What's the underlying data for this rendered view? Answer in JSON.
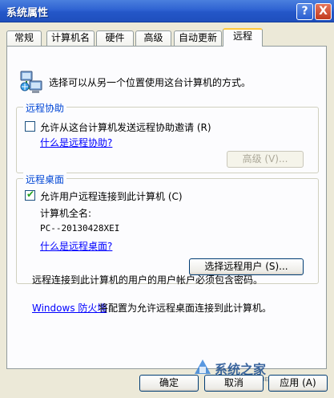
{
  "window": {
    "title": "系统属性",
    "help_glyph": "?",
    "close_glyph": "X"
  },
  "tabs": [
    {
      "label": "常规"
    },
    {
      "label": "计算机名"
    },
    {
      "label": "硬件"
    },
    {
      "label": "高级"
    },
    {
      "label": "自动更新"
    },
    {
      "label": "远程",
      "active": true
    }
  ],
  "intro": {
    "icon": "remote-computers-icon",
    "text": "选择可以从另一个位置使用这台计算机的方式。"
  },
  "remote_assistance": {
    "legend": "远程协助",
    "checkbox_label": "允许从这台计算机发送远程协助邀请 (R)",
    "checked": false,
    "link": "什么是远程协助?",
    "advanced_button": "高级 (V)..."
  },
  "remote_desktop": {
    "legend": "远程桌面",
    "checkbox_label": "允许用户远程连接到此计算机 (C)",
    "checked": true,
    "full_name_label": "计算机全名:",
    "full_name_value": "PC--20130428XEI",
    "link": "什么是远程桌面?",
    "select_users_button": "选择远程用户 (S)..."
  },
  "password_note": "远程连接到此计算机的用户的用户帐户必须包含密码。",
  "firewall": {
    "link": "Windows 防火墙",
    "text": "将配置为允许远程桌面连接到此计算机。"
  },
  "buttons": {
    "ok": "确定",
    "cancel": "取消",
    "apply": "应用 (A)"
  },
  "watermark": {
    "text": "系统之家",
    "sub": "XITONGZHIJIA.NET"
  }
}
